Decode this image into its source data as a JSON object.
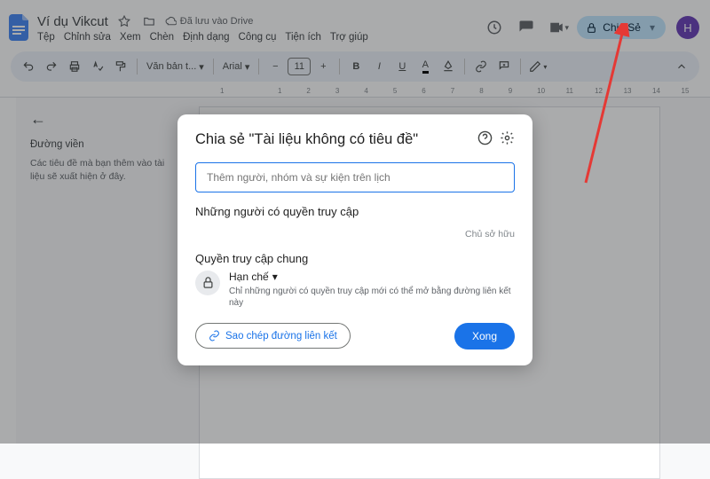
{
  "header": {
    "doc_title": "Ví dụ Vikcut",
    "drive_status": "Đã lưu vào Drive",
    "menu": [
      "Tệp",
      "Chỉnh sửa",
      "Xem",
      "Chèn",
      "Định dạng",
      "Công cụ",
      "Tiện ích",
      "Trợ giúp"
    ],
    "share_label": "Chia Sẻ",
    "avatar_letter": "H"
  },
  "toolbar": {
    "style_select": "Văn bản t...",
    "font_select": "Arial",
    "font_size": "11"
  },
  "ruler": [
    "1",
    "",
    "1",
    "2",
    "3",
    "4",
    "5",
    "6",
    "7",
    "8",
    "9",
    "10",
    "11",
    "12",
    "13",
    "14",
    "15"
  ],
  "outline": {
    "title": "Đường viền",
    "desc": "Các tiêu đề mà bạn thêm vào tài liệu sẽ xuất hiện ở đây."
  },
  "dialog": {
    "title": "Chia sẻ \"Tài liệu không có tiêu đề\"",
    "input_placeholder": "Thêm người, nhóm và sự kiện trên lịch",
    "access_title": "Những người có quyền truy cập",
    "owner_label": "Chủ sở hữu",
    "general_title": "Quyền truy cập chung",
    "restricted_label": "Hạn chế",
    "restricted_desc": "Chỉ những người có quyền truy cập mới có thể mở bằng đường liên kết này",
    "copy_link": "Sao chép đường liên kết",
    "done": "Xong"
  }
}
